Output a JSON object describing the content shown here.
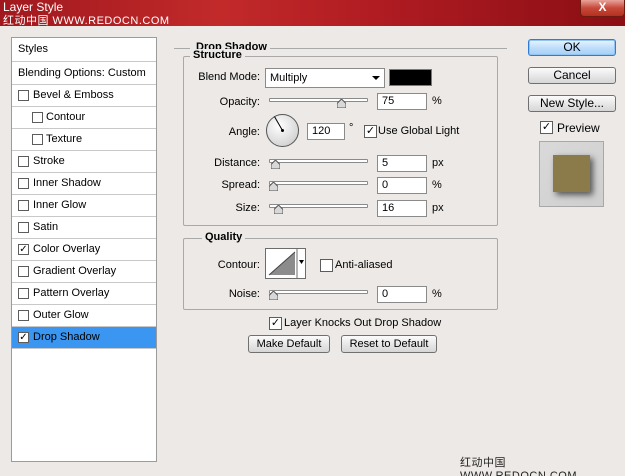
{
  "window": {
    "title": "Layer Style",
    "watermark": "红动中国 WWW.REDOCN.COM",
    "close_label": "X"
  },
  "sidebar": {
    "header": "Styles",
    "blending": "Blending Options: Custom",
    "items": [
      {
        "label": "Bevel & Emboss",
        "checked": false,
        "indent": false
      },
      {
        "label": "Contour",
        "checked": false,
        "indent": true
      },
      {
        "label": "Texture",
        "checked": false,
        "indent": true
      },
      {
        "label": "Stroke",
        "checked": false,
        "indent": false
      },
      {
        "label": "Inner Shadow",
        "checked": false,
        "indent": false
      },
      {
        "label": "Inner Glow",
        "checked": false,
        "indent": false
      },
      {
        "label": "Satin",
        "checked": false,
        "indent": false
      },
      {
        "label": "Color Overlay",
        "checked": true,
        "indent": false
      },
      {
        "label": "Gradient Overlay",
        "checked": false,
        "indent": false
      },
      {
        "label": "Pattern Overlay",
        "checked": false,
        "indent": false
      },
      {
        "label": "Outer Glow",
        "checked": false,
        "indent": false
      },
      {
        "label": "Drop Shadow",
        "checked": true,
        "indent": false,
        "selected": true
      }
    ]
  },
  "panel": {
    "title": "Drop Shadow",
    "structure": {
      "title": "Structure",
      "blend_mode_label": "Blend Mode:",
      "blend_mode_value": "Multiply",
      "shadow_color": "#000000",
      "opacity_label": "Opacity:",
      "opacity_value": "75",
      "opacity_percent": 75,
      "opacity_unit": "%",
      "angle_label": "Angle:",
      "angle_value": "120",
      "angle_unit": "°",
      "use_global_light_label": "Use Global Light",
      "use_global_light": true,
      "distance_label": "Distance:",
      "distance_value": "5",
      "distance_unit": "px",
      "distance_fraction": 0.02,
      "spread_label": "Spread:",
      "spread_value": "0",
      "spread_unit": "%",
      "spread_fraction": 0.0,
      "size_label": "Size:",
      "size_value": "16",
      "size_unit": "px",
      "size_fraction": 0.06
    },
    "quality": {
      "title": "Quality",
      "contour_label": "Contour:",
      "anti_aliased_label": "Anti-aliased",
      "anti_aliased": false,
      "noise_label": "Noise:",
      "noise_value": "0",
      "noise_unit": "%",
      "noise_fraction": 0.0
    },
    "layer_knocks_label": "Layer Knocks Out Drop Shadow",
    "layer_knocks": true,
    "make_default": "Make Default",
    "reset_default": "Reset to Default"
  },
  "actions": {
    "ok": "OK",
    "cancel": "Cancel",
    "new_style": "New Style...",
    "preview_label": "Preview",
    "preview_checked": true,
    "preview_color": "#8b7b4a"
  },
  "footer": {
    "watermark": "红动中国 WWW.REDOCN.COM"
  }
}
